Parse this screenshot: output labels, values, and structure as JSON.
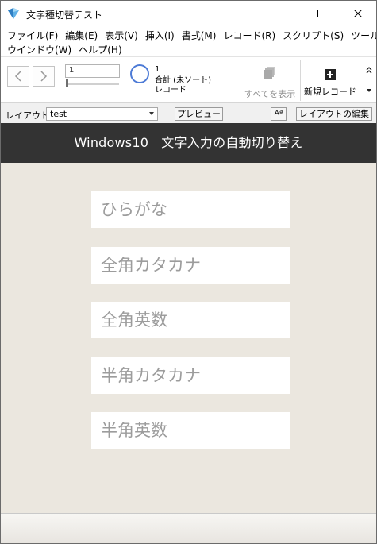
{
  "window": {
    "title": "文字種切替テスト",
    "accent_color": "#4d7bd6"
  },
  "menu": {
    "row1": [
      "ファイル(F)",
      "編集(E)",
      "表示(V)",
      "挿入(I)",
      "書式(M)",
      "レコード(R)",
      "スクリプト(S)",
      "ツール(T)"
    ],
    "row2": [
      "ウインドウ(W)",
      "ヘルプ(H)"
    ]
  },
  "toolbar": {
    "record_input_value": "1",
    "record_count": "1",
    "total_label": "合計 (未ソート)",
    "records_label": "レコード",
    "show_all_label": "すべてを表示",
    "new_record_label": "新規レコード"
  },
  "layoutbar": {
    "layout_label": "レイアウト:",
    "layout_value": "test",
    "preview_label": "プレビュー",
    "aa_label": "Aª",
    "edit_layout_label": "レイアウトの編集"
  },
  "content": {
    "header_title": "Windows10　文字入力の自動切り替え",
    "header_bg": "#333333",
    "body_bg": "#ebe7df",
    "fields": [
      {
        "placeholder": "ひらがな"
      },
      {
        "placeholder": "全角カタカナ"
      },
      {
        "placeholder": "全角英数"
      },
      {
        "placeholder": "半角カタカナ"
      },
      {
        "placeholder": "半角英数"
      }
    ]
  }
}
